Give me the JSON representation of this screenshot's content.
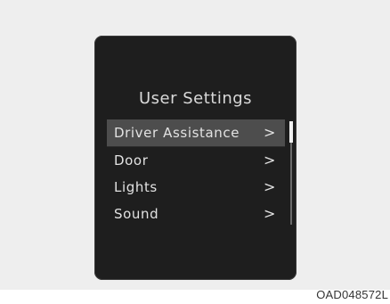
{
  "screen": {
    "title": "User Settings",
    "menu_items": [
      {
        "label": "Driver Assistance",
        "chevron": ">"
      },
      {
        "label": "Door",
        "chevron": ">"
      },
      {
        "label": "Lights",
        "chevron": ">"
      },
      {
        "label": "Sound",
        "chevron": ">"
      }
    ],
    "selected_index": 0
  },
  "figure_code": "OAD048572L",
  "icons": {
    "chevron": "chevron-right-icon"
  },
  "colors": {
    "screen_bg": "#1e1e1e",
    "selected_bg": "#4d4d4d",
    "text": "#e2e2e2",
    "page_bg": "#eeeeee"
  }
}
